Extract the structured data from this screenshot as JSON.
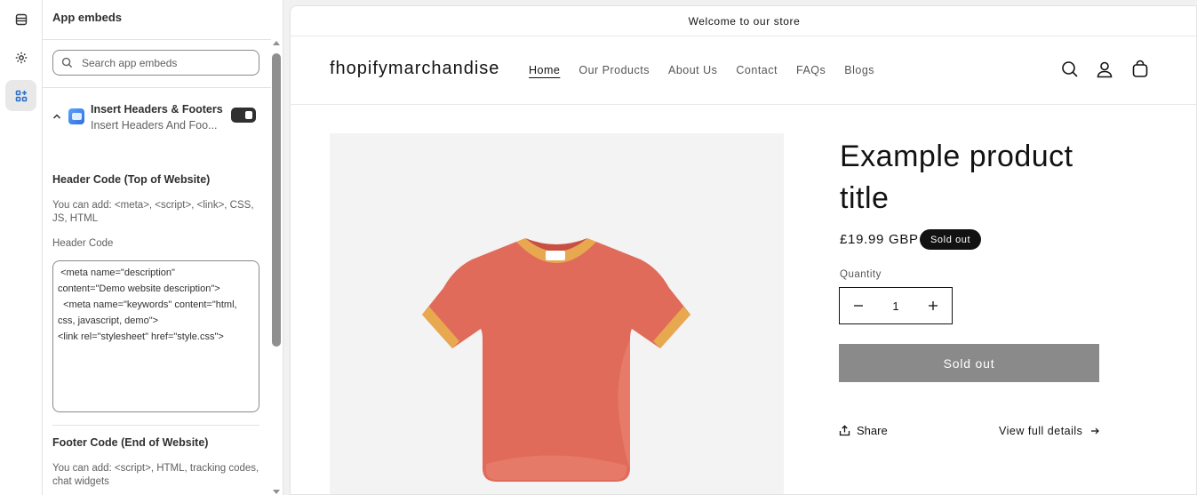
{
  "rail": {
    "items": [
      {
        "icon": "sections-icon",
        "active": false
      },
      {
        "icon": "gear-icon",
        "active": false
      },
      {
        "icon": "app-embeds-icon",
        "active": true
      }
    ]
  },
  "panel": {
    "title": "App embeds",
    "search_placeholder": "Search app embeds",
    "embed": {
      "name": "Insert Headers & Footers",
      "subtitle": "Insert Headers And Foo...",
      "enabled": true
    },
    "header_section": {
      "heading": "Header Code (Top of Website)",
      "help": "You can add: <meta>, <script>, <link>, CSS, JS, HTML",
      "field_label": "Header Code",
      "code": " <meta name=\"description\"\ncontent=\"Demo website description\">\n  <meta name=\"keywords\" content=\"html,\ncss, javascript, demo\">\n<link rel=\"stylesheet\" href=\"style.css\">"
    },
    "footer_section": {
      "heading": "Footer Code (End of Website)",
      "help": "You can add: <script>, HTML, tracking codes, chat widgets"
    }
  },
  "store": {
    "announcement": "Welcome to our store",
    "logo": "fhopifymarchandise",
    "nav": [
      "Home",
      "Our Products",
      "About Us",
      "Contact",
      "FAQs",
      "Blogs"
    ],
    "current_nav": "Home",
    "header_icons": [
      "search-icon",
      "account-icon",
      "cart-icon"
    ],
    "product": {
      "title": "Example product title",
      "price": "£19.99 GBP",
      "badge": "Sold out",
      "quantity_label": "Quantity",
      "quantity": "1",
      "button": "Sold out",
      "share": "Share",
      "view_details": "View full details"
    },
    "colors": {
      "shirt": "#e06b5a",
      "shirt_trim": "#e8a84f",
      "button_disabled": "#8a8a8a",
      "text": "#121212"
    }
  }
}
